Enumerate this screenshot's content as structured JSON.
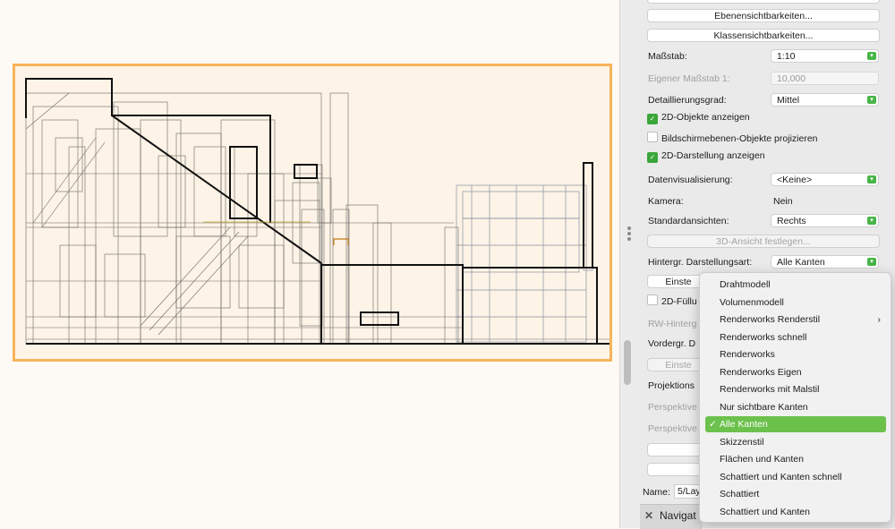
{
  "panel": {
    "buttons_top": [
      "Ebenensichtbarkeiten...",
      "Klassensichtbarkeiten..."
    ],
    "scale_label": "Maßstab:",
    "scale_value": "1:10",
    "own_scale_label": "Eigener Maßstab 1:",
    "own_scale_value": "10,000",
    "detail_label": "Detaillierungsgrad:",
    "detail_value": "Mittel",
    "chk_2d_objects": "2D-Objekte anzeigen",
    "chk_screen_layers": "Bildschirmebenen-Objekte projizieren",
    "chk_2d_display": "2D-Darstellung anzeigen",
    "data_vis_label": "Datenvisualisierung:",
    "data_vis_value": "<Keine>",
    "camera_label": "Kamera:",
    "camera_value": "Nein",
    "standard_views_label": "Standardansichten:",
    "standard_views_value": "Rechts",
    "set_3d_view": "3D-Ansicht festlegen...",
    "bg_render_label": "Hintergr. Darstellungsart:",
    "bg_render_value": "Alle Kanten",
    "settings_btn_1": "Einste",
    "chk_2d_fill": "2D-Füllu",
    "rw_bg_label": "RW-Hinterg",
    "fg_label": "Vordergr. D",
    "settings_btn_2": "Einste",
    "projection_label": "Projektions",
    "perspective_label_1": "Perspektive",
    "perspective_label_2": "Perspektive",
    "name_label": "Name:",
    "name_value": "5/Lay",
    "navigator_label": "Navigat"
  },
  "menu": {
    "items": [
      {
        "label": "Drahtmodell"
      },
      {
        "label": "Volumenmodell"
      },
      {
        "label": "Renderworks Renderstil",
        "submenu": true
      },
      {
        "label": "Renderworks schnell"
      },
      {
        "label": "Renderworks"
      },
      {
        "label": "Renderworks Eigen"
      },
      {
        "label": "Renderworks mit Malstil"
      },
      {
        "label": "Nur sichtbare Kanten"
      },
      {
        "label": "Alle Kanten",
        "selected": true
      },
      {
        "label": "Skizzenstil"
      },
      {
        "label": "Flächen und Kanten"
      },
      {
        "label": "Schattiert und Kanten schnell"
      },
      {
        "label": "Schattiert"
      },
      {
        "label": "Schattiert und Kanten"
      }
    ],
    "check_glyph": "✓",
    "submenu_glyph": "›"
  },
  "colors": {
    "viewport_border": "#f6b45a",
    "viewport_bg": "#fdf3e6",
    "accent_green": "#47b547",
    "menu_highlight": "#6cc14c"
  }
}
